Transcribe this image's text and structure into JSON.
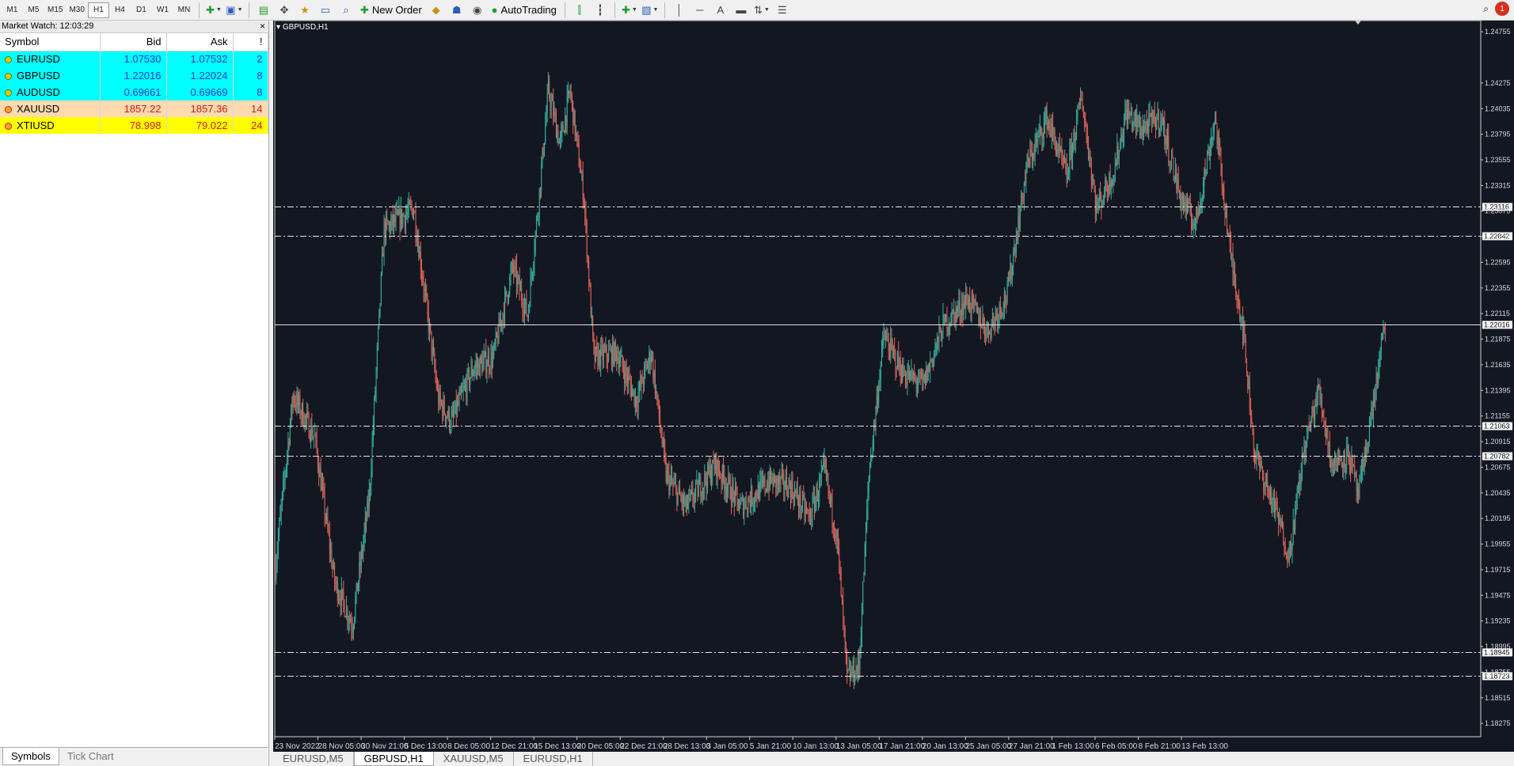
{
  "toolbar": {
    "timeframes": [
      "M1",
      "M5",
      "M15",
      "M30",
      "H1",
      "H4",
      "D1",
      "W1",
      "MN"
    ],
    "active_timeframe": "H1",
    "new_order_label": "New Order",
    "autotrading_label": "AutoTrading",
    "notification_count": "1"
  },
  "market_watch": {
    "title": "Market Watch: 12:03:29",
    "close_label": "×",
    "headers": {
      "symbol": "Symbol",
      "bid": "Bid",
      "ask": "Ask",
      "spread": "!"
    },
    "rows": [
      {
        "symbol": "EURUSD",
        "bid": "1.07530",
        "ask": "1.07532",
        "spread": "2",
        "bg": "#00ffff",
        "color": "#1a37d8",
        "dir": "up"
      },
      {
        "symbol": "GBPUSD",
        "bid": "1.22016",
        "ask": "1.22024",
        "spread": "8",
        "bg": "#00ffff",
        "color": "#1a37d8",
        "dir": "up"
      },
      {
        "symbol": "AUDUSD",
        "bid": "0.69661",
        "ask": "0.69669",
        "spread": "8",
        "bg": "#00ffff",
        "color": "#1a37d8",
        "dir": "up"
      },
      {
        "symbol": "XAUUSD",
        "bid": "1857.22",
        "ask": "1857.36",
        "spread": "14",
        "bg": "#ffdab0",
        "color": "#d21a1a",
        "dir": "down"
      },
      {
        "symbol": "XTIUSD",
        "bid": "78.998",
        "ask": "79.022",
        "spread": "24",
        "bg": "#ffff00",
        "color": "#d21a1a",
        "dir": "down"
      }
    ],
    "tabs": [
      "Symbols",
      "Tick Chart"
    ],
    "active_tab": "Symbols"
  },
  "chart_data": {
    "type": "candlestick",
    "title": "GBPUSD,H1",
    "ylim": [
      1.1815,
      1.2486
    ],
    "y_ticks": [
      "1.24755",
      "1.24275",
      "1.24035",
      "1.23795",
      "1.23555",
      "1.23315",
      "1.23075",
      "1.22835",
      "1.22595",
      "1.22355",
      "1.22115",
      "1.21875",
      "1.21635",
      "1.21395",
      "1.21155",
      "1.20915",
      "1.20675",
      "1.20435",
      "1.20195",
      "1.19955",
      "1.19715",
      "1.19475",
      "1.19235",
      "1.18995",
      "1.18755",
      "1.18515",
      "1.18275"
    ],
    "x_ticks": [
      "23 Nov 2022",
      "28 Nov 05:00",
      "30 Nov 21:00",
      "5 Dec 13:00",
      "8 Dec 05:00",
      "12 Dec 21:00",
      "15 Dec 13:00",
      "20 Dec 05:00",
      "22 Dec 21:00",
      "28 Dec 13:00",
      "3 Jan 05:00",
      "5 Jan 21:00",
      "10 Jan 13:00",
      "13 Jan 05:00",
      "17 Jan 21:00",
      "20 Jan 13:00",
      "25 Jan 05:00",
      "27 Jan 21:00",
      "1 Feb 13:00",
      "6 Feb 05:00",
      "8 Feb 21:00",
      "13 Feb 13:00"
    ],
    "levels": [
      {
        "value": 1.23116,
        "label": "1.23116",
        "style": "dashdot"
      },
      {
        "value": 1.22842,
        "label": "1.22842",
        "style": "dashdot"
      },
      {
        "value": 1.22016,
        "label": "1.22016",
        "style": "solid"
      },
      {
        "value": 1.21063,
        "label": "1.21063",
        "style": "dashdot"
      },
      {
        "value": 1.20782,
        "label": "1.20782",
        "style": "dashdot"
      },
      {
        "value": 1.18945,
        "label": "1.18945",
        "style": "dashdot"
      },
      {
        "value": 1.18723,
        "label": "1.18723",
        "style": "dashdot"
      }
    ],
    "waypoints": [
      [
        0,
        1.1975
      ],
      [
        18,
        1.2135
      ],
      [
        40,
        1.2095
      ],
      [
        60,
        1.196
      ],
      [
        78,
        1.192
      ],
      [
        95,
        1.204
      ],
      [
        110,
        1.229
      ],
      [
        140,
        1.231
      ],
      [
        165,
        1.213
      ],
      [
        178,
        1.211
      ],
      [
        200,
        1.216
      ],
      [
        220,
        1.217
      ],
      [
        240,
        1.2255
      ],
      [
        255,
        1.221
      ],
      [
        266,
        1.2315
      ],
      [
        276,
        1.242
      ],
      [
        288,
        1.237
      ],
      [
        298,
        1.242
      ],
      [
        312,
        1.232
      ],
      [
        322,
        1.217
      ],
      [
        345,
        1.2175
      ],
      [
        365,
        1.213
      ],
      [
        380,
        1.2175
      ],
      [
        395,
        1.206
      ],
      [
        415,
        1.203
      ],
      [
        445,
        1.207
      ],
      [
        470,
        1.203
      ],
      [
        500,
        1.2055
      ],
      [
        520,
        1.205
      ],
      [
        540,
        1.202
      ],
      [
        555,
        1.2065
      ],
      [
        568,
        1.2
      ],
      [
        578,
        1.187
      ],
      [
        590,
        1.188
      ],
      [
        600,
        1.206
      ],
      [
        615,
        1.219
      ],
      [
        635,
        1.2155
      ],
      [
        655,
        1.2145
      ],
      [
        675,
        1.22
      ],
      [
        700,
        1.2225
      ],
      [
        720,
        1.2195
      ],
      [
        740,
        1.223
      ],
      [
        760,
        1.235
      ],
      [
        780,
        1.2395
      ],
      [
        800,
        1.234
      ],
      [
        815,
        1.2415
      ],
      [
        830,
        1.231
      ],
      [
        848,
        1.2345
      ],
      [
        860,
        1.24
      ],
      [
        875,
        1.2385
      ],
      [
        895,
        1.2395
      ],
      [
        915,
        1.232
      ],
      [
        930,
        1.2295
      ],
      [
        950,
        1.2395
      ],
      [
        965,
        1.227
      ],
      [
        978,
        1.22
      ],
      [
        990,
        1.208
      ],
      [
        1010,
        1.203
      ],
      [
        1025,
        1.1985
      ],
      [
        1040,
        1.2085
      ],
      [
        1055,
        1.214
      ],
      [
        1068,
        1.207
      ],
      [
        1085,
        1.208
      ],
      [
        1095,
        1.204
      ],
      [
        1112,
        1.214
      ],
      [
        1122,
        1.2205
      ]
    ],
    "up_color": "#38b2a0",
    "down_color": "#e0655a",
    "background": "#131722"
  },
  "chart_tabs": [
    "EURUSD,M5",
    "GBPUSD,H1",
    "XAUUSD,M5",
    "EURUSD,H1"
  ],
  "active_chart_tab": "GBPUSD,H1"
}
